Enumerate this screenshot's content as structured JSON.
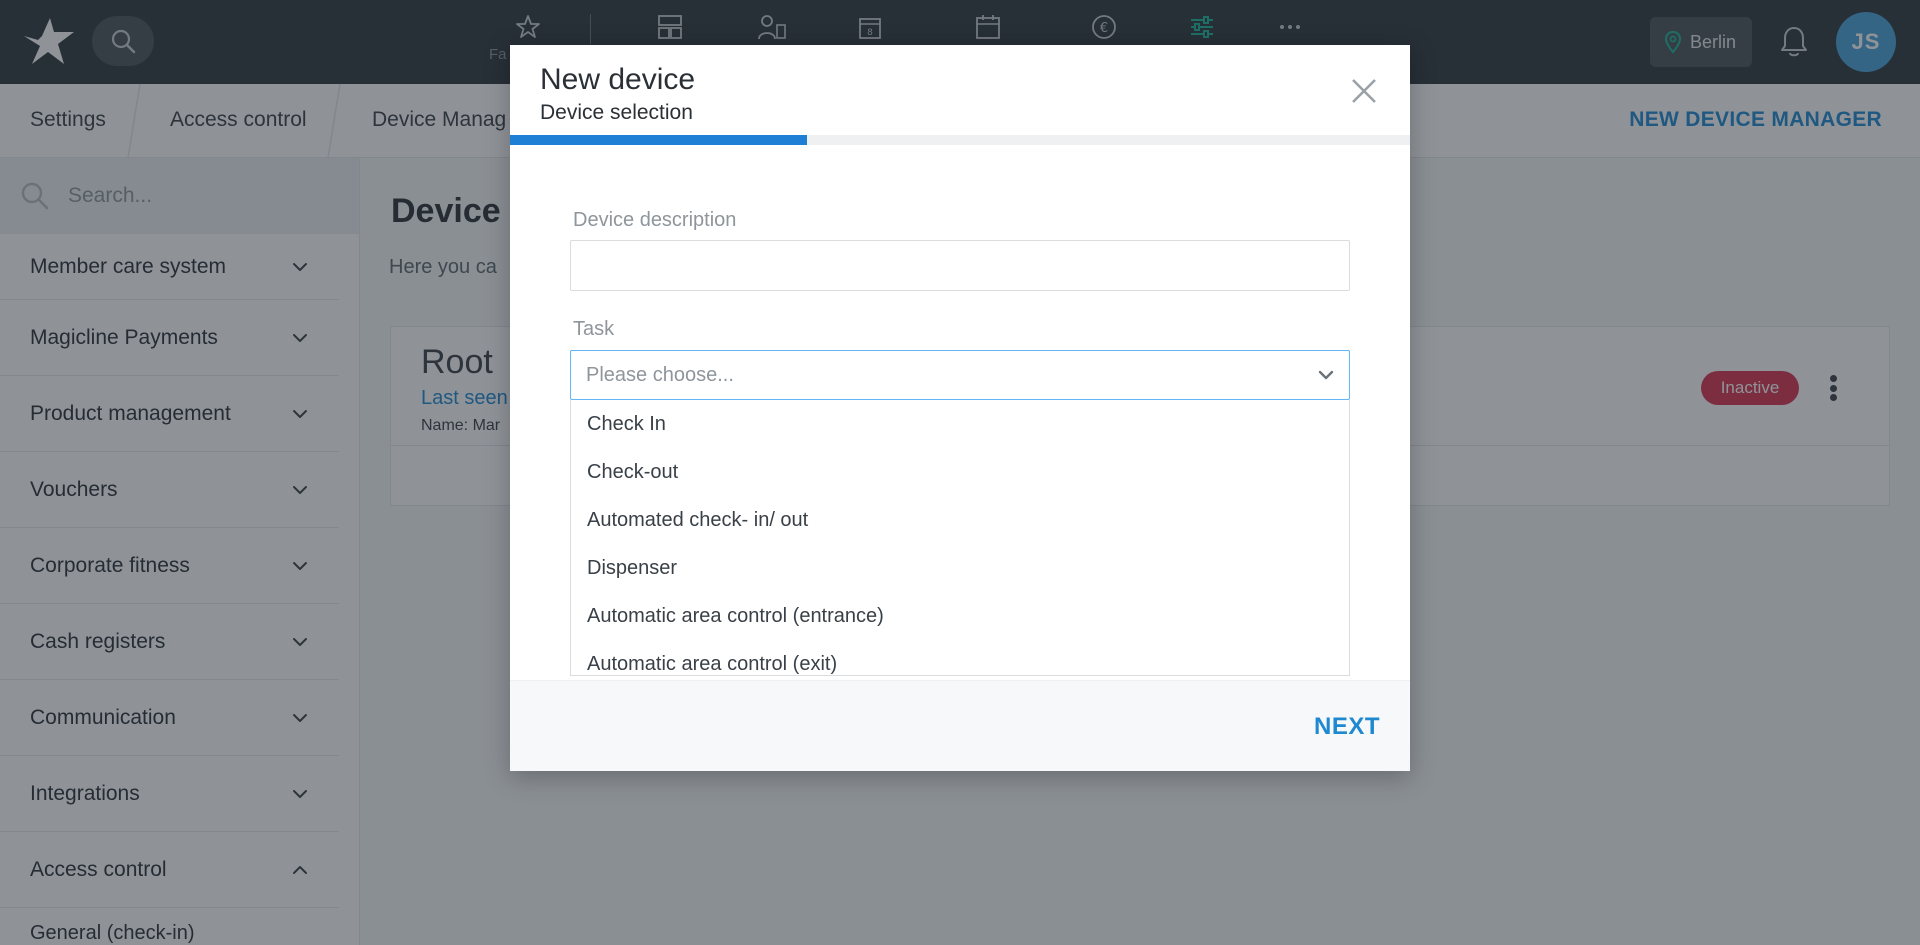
{
  "topbar": {
    "favorites_label": "Fa",
    "location": "Berlin",
    "avatar_initials": "JS",
    "accent_active": "#1fb59a"
  },
  "breadcrumb": {
    "items": [
      "Settings",
      "Access control",
      "Device Manag"
    ],
    "action": "NEW DEVICE MANAGER"
  },
  "sidebar": {
    "search_placeholder": "Search...",
    "items": [
      {
        "label": "Member care system",
        "expanded": false
      },
      {
        "label": "Magicline Payments",
        "expanded": false
      },
      {
        "label": "Product management",
        "expanded": false
      },
      {
        "label": "Vouchers",
        "expanded": false
      },
      {
        "label": "Corporate fitness",
        "expanded": false
      },
      {
        "label": "Cash registers",
        "expanded": false
      },
      {
        "label": "Communication",
        "expanded": false
      },
      {
        "label": "Integrations",
        "expanded": false
      },
      {
        "label": "Access control",
        "expanded": true
      }
    ],
    "subitem": "General (check-in)"
  },
  "main": {
    "title": "Device M",
    "description": "Here you ca",
    "card": {
      "root_label": "Root",
      "last_seen": "Last seen",
      "name_line": "Name: Mar",
      "status": "Inactive",
      "status_color": "#d8344f"
    }
  },
  "modal": {
    "title": "New device",
    "subtitle": "Device selection",
    "progress_percent": 33,
    "description_label": "Device description",
    "description_value": "",
    "task_label": "Task",
    "task_placeholder": "Please choose...",
    "task_options": [
      "Check In",
      "Check-out",
      "Automated check- in/ out",
      "Dispenser",
      "Automatic area control (entrance)",
      "Automatic area control (exit)"
    ],
    "next_label": "NEXT",
    "accent": "#1e88d0"
  }
}
